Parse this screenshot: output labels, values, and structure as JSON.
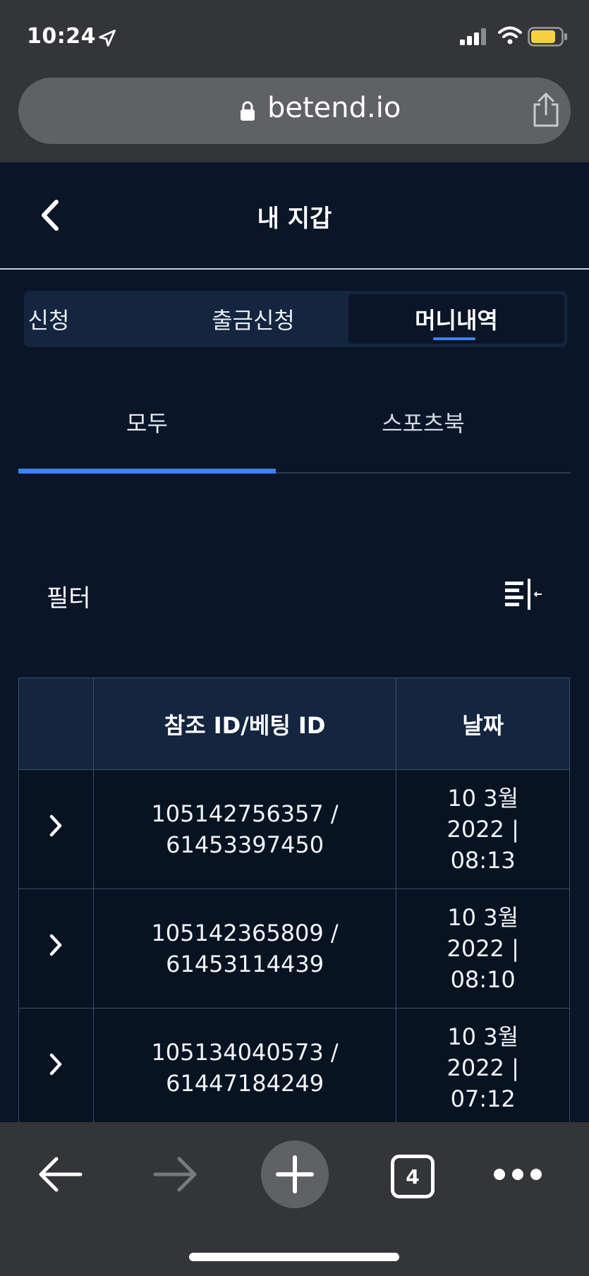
{
  "status_bar": {
    "time": "10:24"
  },
  "browser": {
    "url": "betend.io",
    "tab_count": "4"
  },
  "header": {
    "title": "내 지갑"
  },
  "segments": [
    {
      "label": "신청"
    },
    {
      "label": "출금신청"
    },
    {
      "label": "머니내역"
    }
  ],
  "subtabs": {
    "all": "모두",
    "sportsbook": "스포츠북"
  },
  "filter": {
    "label": "필터"
  },
  "table": {
    "headers": {
      "expand": "",
      "ref_id": "참조 ID/베팅 ID",
      "date": "날짜"
    },
    "rows": [
      {
        "ref_a": "105142756357 /",
        "ref_b": "61453397450",
        "d1": "10 3월",
        "d2": "2022 |",
        "d3": "08:13"
      },
      {
        "ref_a": "105142365809 /",
        "ref_b": "61453114439",
        "d1": "10 3월",
        "d2": "2022 |",
        "d3": "08:10"
      },
      {
        "ref_a": "105134040573 /",
        "ref_b": "61447184249",
        "d1": "10 3월",
        "d2": "2022 |",
        "d3": "07:12"
      }
    ]
  },
  "colors": {
    "accent": "#3b82f6",
    "background": "#0a1528",
    "panel": "#13253f",
    "battery": "#f5d142"
  }
}
